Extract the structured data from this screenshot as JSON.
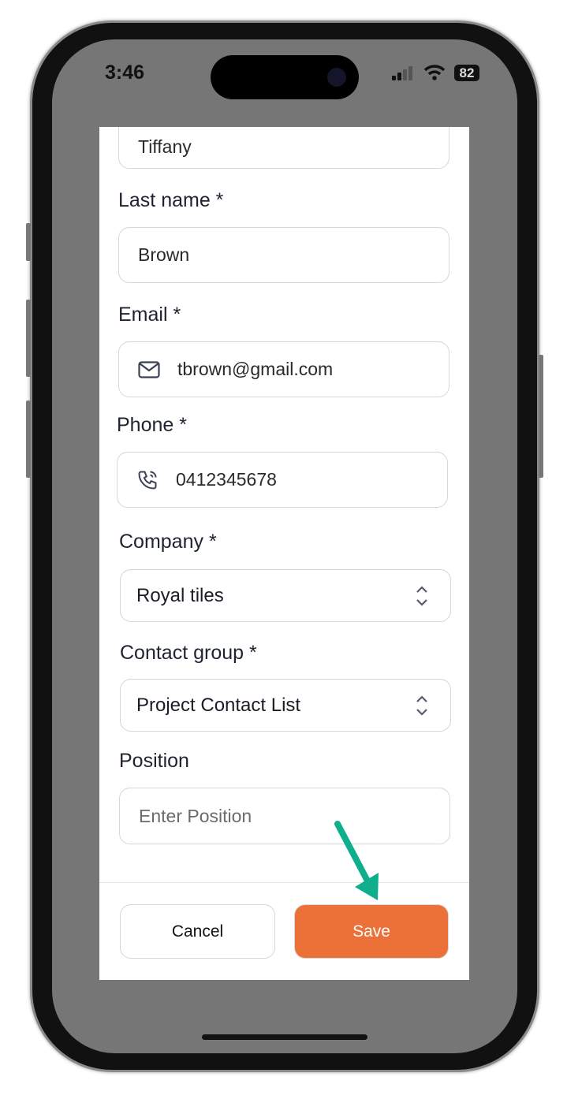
{
  "status_bar": {
    "time": "3:46",
    "battery": "82"
  },
  "form": {
    "first_name_value": "Tiffany",
    "last_name": {
      "label": "Last name *",
      "value": "Brown"
    },
    "email": {
      "label": "Email *",
      "value": "tbrown@gmail.com",
      "icon": "mail-icon"
    },
    "phone": {
      "label": "Phone *",
      "value": "0412345678",
      "icon": "phone-icon"
    },
    "company": {
      "label": "Company *",
      "value": "Royal tiles"
    },
    "contact_group": {
      "label": "Contact group *",
      "value": "Project Contact List"
    },
    "position": {
      "label": "Position",
      "placeholder": "Enter Position"
    }
  },
  "footer": {
    "cancel_label": "Cancel",
    "save_label": "Save"
  },
  "colors": {
    "save": "#ec7139",
    "arrow": "#0fae8c"
  }
}
